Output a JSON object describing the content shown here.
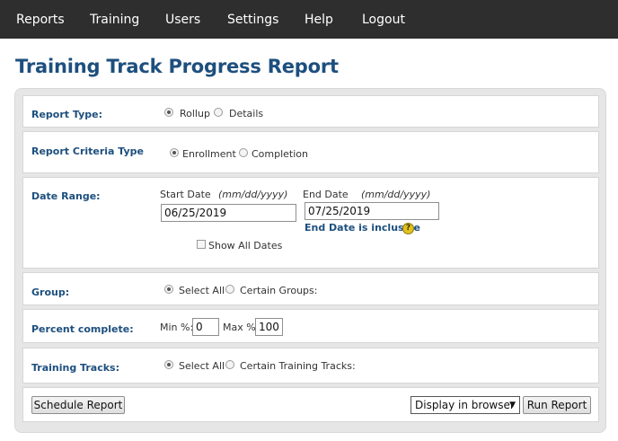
{
  "nav": {
    "items": [
      "Reports",
      "Training",
      "Users",
      "Settings",
      "Help",
      "Logout"
    ]
  },
  "page": {
    "title": "Training Track Progress Report"
  },
  "report_type": {
    "label": "Report Type:",
    "options": [
      "Rollup",
      "Details"
    ],
    "selected": "Rollup"
  },
  "criteria": {
    "label": "Report Criteria Type",
    "options": [
      "Enrollment",
      "Completion"
    ],
    "selected": "Enrollment"
  },
  "date_range": {
    "label": "Date Range:",
    "start_label": "Start Date",
    "start_hint": "(mm/dd/yyyy)",
    "start_value": "06/25/2019",
    "end_label": "End Date",
    "end_hint": "(mm/dd/yyyy)",
    "end_value": "07/25/2019",
    "inclusive_note": "End Date is inclusive",
    "help_icon": "?",
    "show_all_label": "Show All Dates"
  },
  "group": {
    "label": "Group:",
    "options": [
      "Select All",
      "Certain Groups:"
    ],
    "selected": "Select All"
  },
  "percent": {
    "label": "Percent complete:",
    "min_label": "Min %:",
    "min_value": "0",
    "max_label": "Max %:",
    "max_value": "100"
  },
  "tracks": {
    "label": "Training Tracks:",
    "options": [
      "Select All",
      "Certain Training Tracks:"
    ],
    "selected": "Select All"
  },
  "actions": {
    "schedule_label": "Schedule Report",
    "display_value": "Display in browser",
    "run_label": "Run Report"
  }
}
